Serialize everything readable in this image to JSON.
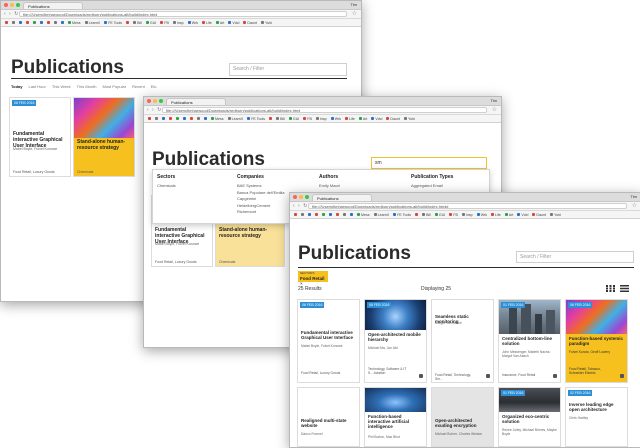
{
  "app_title": "Publications",
  "browser": {
    "tab_title": "Publications",
    "user": "Tim",
    "url_w1": "file:///Users/timharwood/Downloads/redburn/publications-alt/build/index.html",
    "url_w2": "file:///Users/timharwood/Downloads/redburn/publications-alt/build/index.html",
    "url_w3": "file:///Users/timharwood/Downloads/redburn/publications-alt/build/index.html#",
    "bookmarks": [
      "",
      "",
      "",
      "",
      "",
      "",
      "",
      "",
      "",
      "Mess",
      "LearnX",
      "FE Tools",
      "",
      "Bill",
      "GUI",
      "FB",
      "Insp",
      "Wrk",
      "Life",
      "Art",
      "Vdcl",
      "Daunt",
      "Yubi"
    ]
  },
  "search": {
    "placeholder": "Search / Filter",
    "query_w2": "sm"
  },
  "filters": [
    "Today",
    "Last Hour",
    "This Week",
    "This Month",
    "Most Popular",
    "Recent",
    "Etc"
  ],
  "dropdown": {
    "columns": [
      {
        "heading": "Sectors",
        "items": [
          "Chemicals"
        ]
      },
      {
        "heading": "Companies",
        "items": [
          "BAE Systems",
          "Banca Popolare dell'Emilia",
          "Capgemini",
          "HeidelbergCement",
          "Richemont"
        ]
      },
      {
        "heading": "Authors",
        "items": [
          "Emily Maori"
        ]
      },
      {
        "heading": "Publication Types",
        "items": [
          "Aggregated Email"
        ]
      }
    ]
  },
  "w1": {
    "cards": [
      {
        "date": "06 FEB 2016",
        "title": "Fundamental interactive Graphical User Interface",
        "authors": "Mabel Boyle, Fulvel Kunowe",
        "tags": "Food Retail, Luxury Goods"
      },
      {
        "date": "",
        "title": "Stand-alone human-resource strategy",
        "authors": "",
        "tags": "Chemicals"
      }
    ]
  },
  "w2": {
    "cards": [
      {
        "title": "Fundamental interactive Graphical User Interface",
        "authors": "Mabel Boyle, Fulvel Kunowe",
        "tags": "Food Retail, Luxury Goods"
      },
      {
        "title": "Stand-alone human-resource strategy",
        "tags": "Chemicals"
      }
    ]
  },
  "w3": {
    "filter_section": "SECTORS",
    "filter_tag": "Food Retail",
    "filter_close": "×",
    "results": "25 Results",
    "displaying": "Displaying 25",
    "cards": [
      {
        "date": "06 FEB 2016",
        "title": "Fundamental interactive Graphical User Interface",
        "authors": "Mabel Boyle, Fulvel Kunowe",
        "tags": "Food Retail, Luxury Goods"
      },
      {
        "date": "06 FEB 2016",
        "title": "Open-architected mobile hierarchy",
        "authors": "Michael Ma, Jon Abt",
        "tags": "Technology, Software & IT S... Aviation"
      },
      {
        "date": "",
        "title": "Seamless static monitoring",
        "authors": "Margot Van Aasch",
        "tags": "Food Retail, Technology, Sm..."
      },
      {
        "date": "01 FEB 2016",
        "title": "Centralized bottom-line solution",
        "authors": "John Messenger, Mabeth Nacha, Margot Van Aasch",
        "tags": "Insurance, Food Retail"
      },
      {
        "date": "06 FEB 2016",
        "title": "Function-based systemic paradigm",
        "authors": "Fulvel Kunow, Geoff Lowery",
        "tags": "Food Retail, Tobacco, Schneider Electric"
      },
      {
        "date": "",
        "title": "Realigned multi-state website",
        "authors": "Danco Fronnel",
        "tags": ""
      },
      {
        "date": "",
        "title": "Function-based interactive artificial intelligence",
        "authors": "Phil Burton, Max Bhot",
        "tags": ""
      },
      {
        "date": "",
        "title": "Open-architected exuding encryption",
        "authors": "Michael Bohrer, Charles Weston",
        "tags": ""
      },
      {
        "date": "01 FEB 2016",
        "title": "Organized eco-centric solution",
        "authors": "Renee Jolley, Michael Brimes, Maybe Boyle",
        "tags": ""
      },
      {
        "date": "02 FEB 2016",
        "title": "Inverse leading edge open architecture",
        "authors": "Chris Hartley",
        "tags": ""
      }
    ]
  }
}
